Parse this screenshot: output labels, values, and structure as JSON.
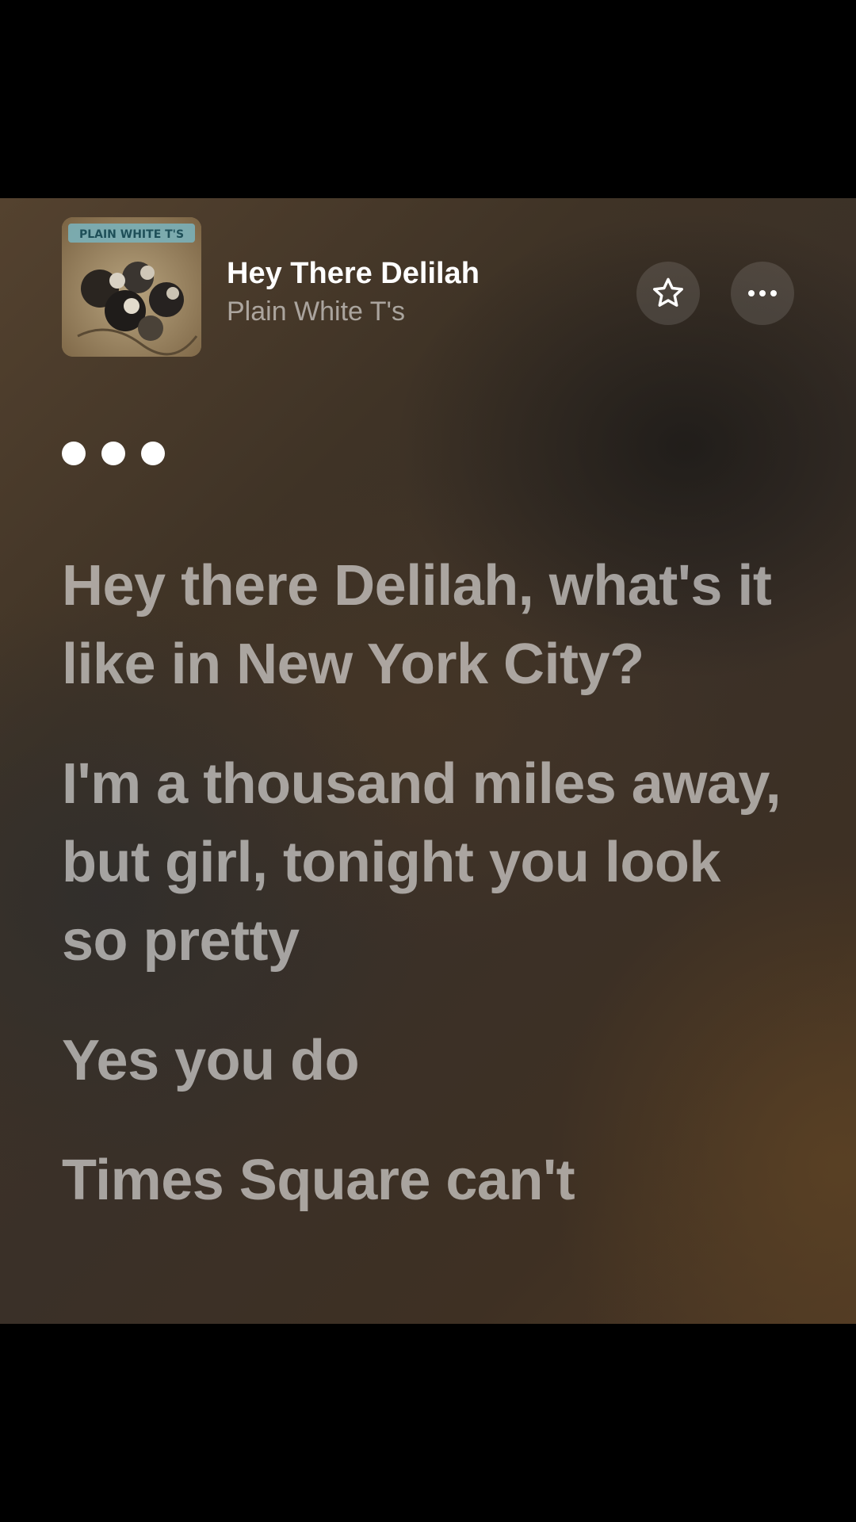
{
  "track": {
    "title": "Hey There Delilah",
    "artist": "Plain White T's",
    "album_art_text": "PLAIN WHITE T'S"
  },
  "icons": {
    "favorite": "star-outline-icon",
    "more": "ellipsis-icon",
    "instrumental": "three-dots-indicator"
  },
  "lyrics": {
    "lines": [
      "Hey there Delilah, what's it like in New York City?",
      "I'm a thousand miles away, but girl, tonight you look so pretty",
      "Yes you do",
      "Times Square can't"
    ]
  },
  "colors": {
    "background_warm": "#4d3824",
    "background_gray": "#3a3430",
    "text_primary": "#ffffff",
    "lyric_inactive": "rgba(255,255,255,0.56)"
  }
}
